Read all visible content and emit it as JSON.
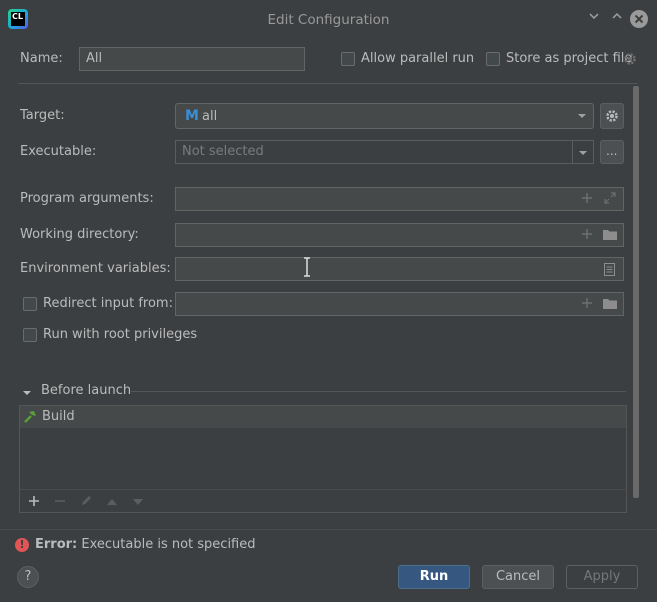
{
  "app": {
    "logo_text": "CL"
  },
  "window": {
    "title": "Edit Configuration"
  },
  "form": {
    "name_label": "Name:",
    "name_value": "All",
    "allow_parallel_label": "Allow parallel run",
    "store_project_label": "Store as project file",
    "target_label": "Target:",
    "target_value": "all",
    "executable_label": "Executable:",
    "executable_placeholder": "Not selected",
    "browse_label": "...",
    "program_args_label": "Program arguments:",
    "working_dir_label": "Working directory:",
    "env_vars_label": "Environment variables:",
    "redirect_input_label": "Redirect input from:",
    "root_privileges_label": "Run with root privileges"
  },
  "before_launch": {
    "title": "Before launch",
    "items": [
      {
        "label": "Build"
      }
    ]
  },
  "error": {
    "prefix": "Error:",
    "message": "Executable is not specified"
  },
  "buttons": {
    "help": "?",
    "run": "Run",
    "cancel": "Cancel",
    "apply": "Apply"
  },
  "colors": {
    "background": "#3c3f41",
    "primary_button": "#365880",
    "error": "#e05555",
    "build_icon": "#5a9e3a",
    "target_icon": "#3a8fd6"
  }
}
